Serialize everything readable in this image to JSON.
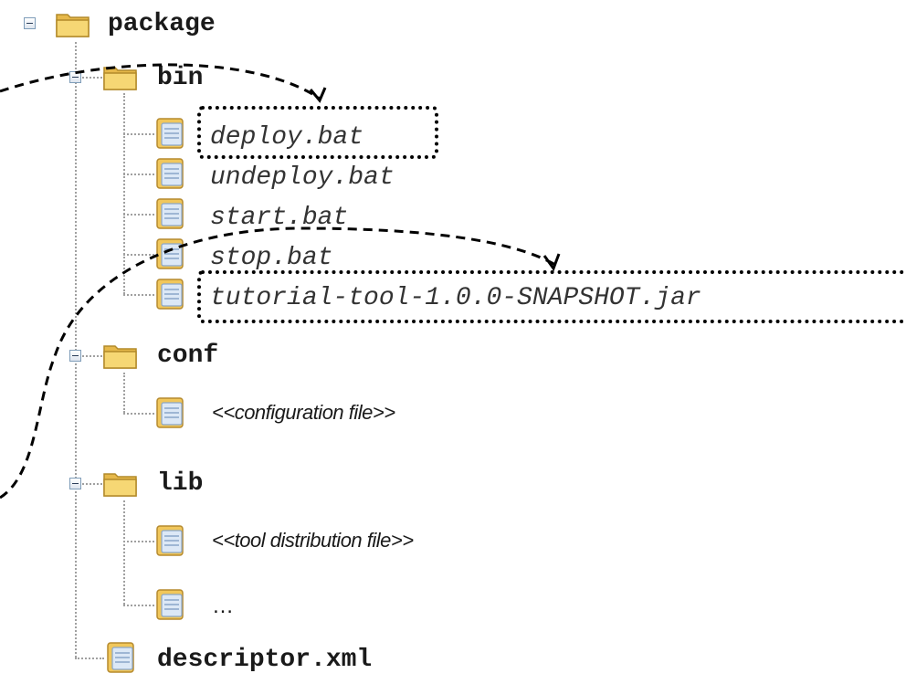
{
  "tree": {
    "root": {
      "label": "package",
      "expanded": true
    },
    "bin": {
      "label": "bin",
      "expanded": true,
      "files": [
        "deploy.bat",
        "undeploy.bat",
        "start.bat",
        "stop.bat",
        "tutorial-tool-1.0.0-SNAPSHOT.jar"
      ]
    },
    "conf": {
      "label": "conf",
      "expanded": true,
      "files": [
        "<<configuration file>>"
      ]
    },
    "lib": {
      "label": "lib",
      "expanded": true,
      "files": [
        "<<tool distribution file>>",
        "…"
      ]
    },
    "descriptor": {
      "label": "descriptor.xml"
    }
  },
  "highlights": [
    "deploy.bat",
    "tutorial-tool-1.0.0-SNAPSHOT.jar"
  ],
  "colors": {
    "folder_body": "#f3d36a",
    "folder_tab": "#f8e391",
    "file_body": "#dce8f6",
    "file_border": "#8aa6c8",
    "arrow": "#000000",
    "tree_line": "#a0a0a0"
  },
  "icons": {
    "toggle": "minus-box-icon",
    "folder": "folder-icon",
    "file": "file-icon"
  }
}
